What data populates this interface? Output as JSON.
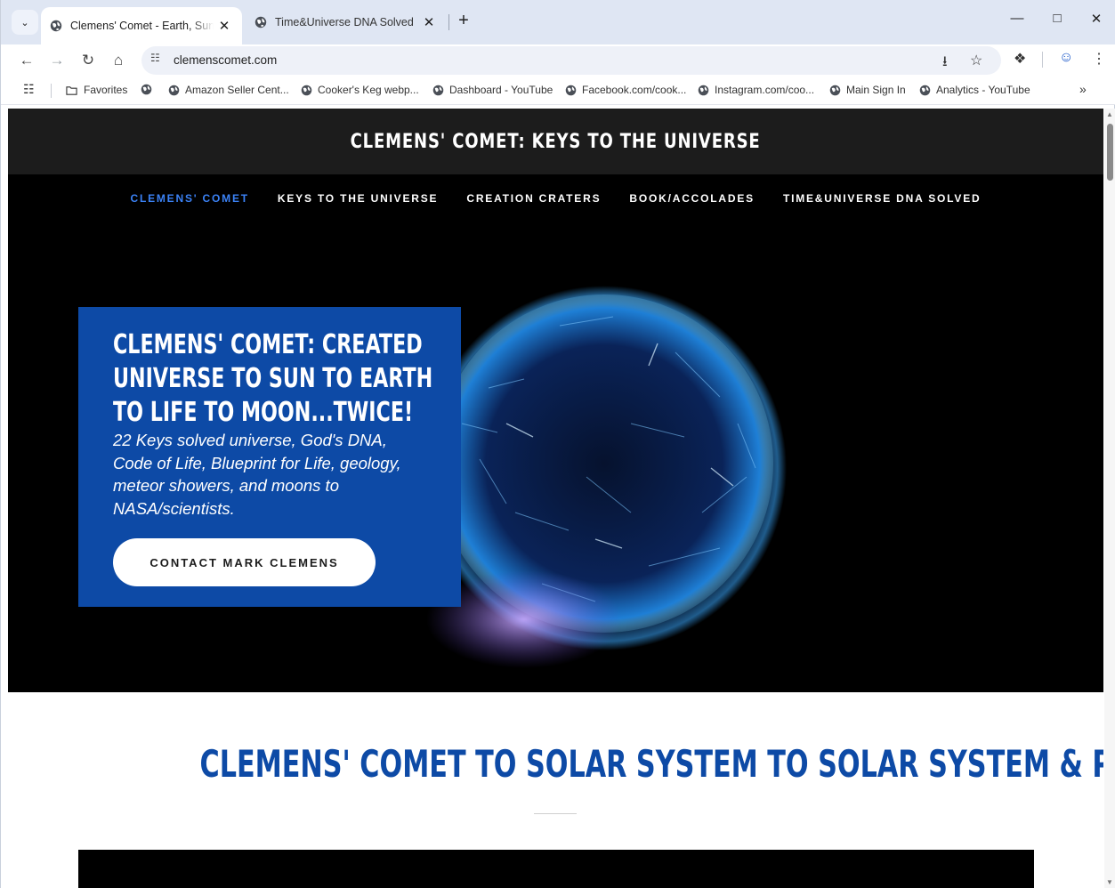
{
  "browser": {
    "tabs": [
      {
        "title": "Clemens' Comet - Earth, Sun, Ea",
        "active": true
      },
      {
        "title": "Time&Universe DNA Solved",
        "active": false
      }
    ],
    "url": "clemenscomet.com",
    "bookmarks": [
      {
        "label": "Favorites",
        "icon": "folder-icon"
      },
      {
        "label": "",
        "icon": "globe-icon"
      },
      {
        "label": "Amazon Seller Cent...",
        "icon": "globe-icon"
      },
      {
        "label": "Cooker's Keg webp...",
        "icon": "globe-icon"
      },
      {
        "label": "Dashboard - YouTube",
        "icon": "globe-icon"
      },
      {
        "label": "Facebook.com/cook...",
        "icon": "globe-icon"
      },
      {
        "label": "Instagram.com/coo...",
        "icon": "globe-icon"
      },
      {
        "label": "Main Sign In",
        "icon": "globe-icon"
      },
      {
        "label": "Analytics - YouTube",
        "icon": "globe-icon"
      }
    ]
  },
  "site": {
    "title": "CLEMENS' COMET: KEYS TO THE UNIVERSE",
    "nav": [
      {
        "label": "CLEMENS' COMET",
        "current": true
      },
      {
        "label": "KEYS TO THE UNIVERSE",
        "current": false
      },
      {
        "label": "CREATION CRATERS",
        "current": false
      },
      {
        "label": "BOOK/ACCOLADES",
        "current": false
      },
      {
        "label": "TIME&UNIVERSE DNA SOLVED",
        "current": false
      }
    ],
    "hero": {
      "heading": "CLEMENS' COMET: CREATED UNIVERSE TO SUN TO EARTH TO LIFE TO MOON...TWICE!",
      "text": "22 Keys solved universe, God's DNA, Code of Life, Blueprint for Life, geology, meteor showers, and moons to NASA/scientists.",
      "cta": "CONTACT MARK CLEMENS"
    },
    "section_heading": "CLEMENS' COMET TO SOLAR SYSTEM TO SOLAR SYSTEM & PRIOR"
  },
  "colors": {
    "accent_blue": "#0d4aa6",
    "nav_current": "#3b82f6",
    "header_bg": "#1c1c1c"
  }
}
